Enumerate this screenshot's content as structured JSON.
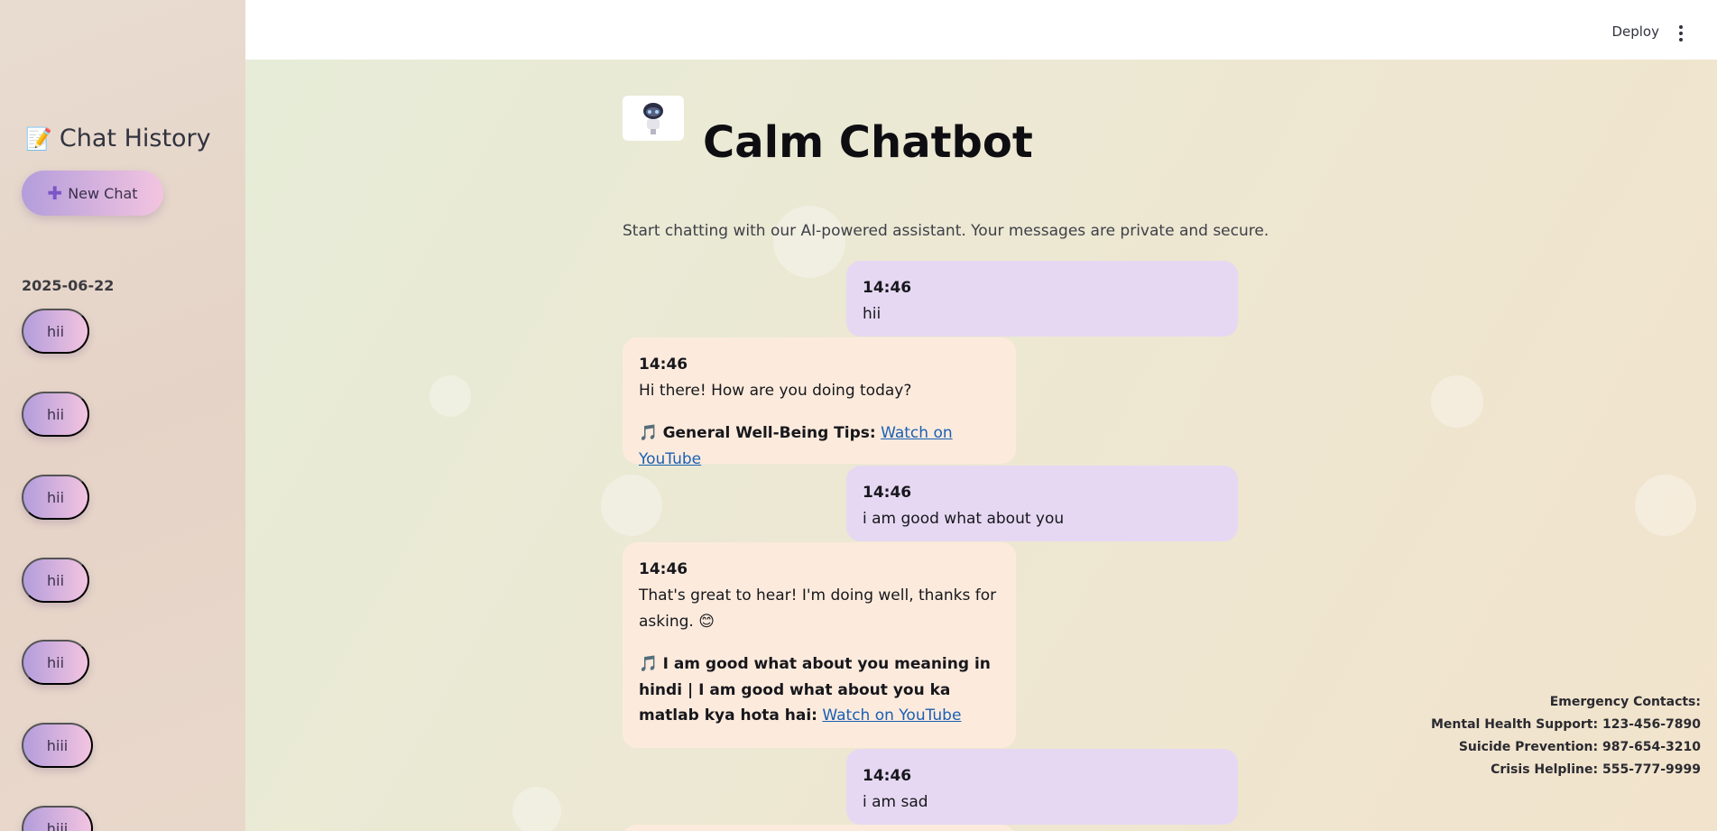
{
  "sidebar": {
    "title": "Chat History",
    "title_icon": "memo-icon",
    "new_chat_label": "New Chat",
    "date": "2025-06-22",
    "items": [
      "hii",
      "hii",
      "hii",
      "hii",
      "hii",
      "hiii",
      "hiii"
    ]
  },
  "topbar": {
    "deploy_label": "Deploy",
    "menu_icon": "kebab-menu-icon"
  },
  "main": {
    "title": "Calm Chatbot",
    "logo_icon": "robot-icon",
    "subtitle": "Start chatting with our AI-powered assistant. Your messages are private and secure."
  },
  "messages": [
    {
      "role": "user",
      "time": "14:46",
      "text": "hii"
    },
    {
      "role": "bot",
      "time": "14:46",
      "text": "Hi there! How are you doing today?",
      "tip_title": "General Well-Being Tips:",
      "tip_link": "Watch on YouTube"
    },
    {
      "role": "user",
      "time": "14:46",
      "text": "i am good what about you"
    },
    {
      "role": "bot",
      "time": "14:46",
      "text": "That's great to hear! I'm doing well, thanks for asking. 😊",
      "tip_title": "I am good what about you meaning in hindi | I am good what about you ka matlab kya hota hai:",
      "tip_link": "Watch on YouTube"
    },
    {
      "role": "user",
      "time": "14:46",
      "text": "i am sad"
    }
  ],
  "emergency": {
    "heading": "Emergency Contacts:",
    "lines": [
      "Mental Health Support: 123-456-7890",
      "Suicide Prevention: 987-654-3210",
      "Crisis Helpline: 555-777-9999"
    ]
  },
  "colors": {
    "user_bubble": "#e6d8f3",
    "bot_bubble": "#fcebdd",
    "button_gradient_start": "#b39ddb",
    "button_gradient_end": "#f3c4e0",
    "link": "#1a5fb4"
  }
}
